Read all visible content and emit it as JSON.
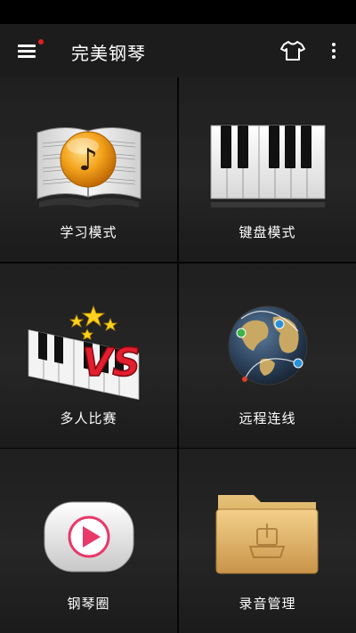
{
  "app_bar": {
    "title": "完美钢琴",
    "menu_icon": "hamburger-menu-icon",
    "notification_dot_color": "#e02020",
    "theme_icon": "tshirt-icon",
    "more_icon": "more-vertical-icon"
  },
  "tiles": [
    {
      "label": "学习模式",
      "icon": "music-book-icon"
    },
    {
      "label": "键盘模式",
      "icon": "piano-keys-icon"
    },
    {
      "label": "多人比赛",
      "icon": "vs-piano-icon"
    },
    {
      "label": "远程连线",
      "icon": "globe-network-icon"
    },
    {
      "label": "钢琴圈",
      "icon": "play-circle-icon"
    },
    {
      "label": "录音管理",
      "icon": "folder-icon"
    }
  ],
  "colors": {
    "background": "#0d0d0d",
    "toolbar": "#1c1c1c",
    "play_accent": "#e8396a",
    "music_note_orange": "#f0a020",
    "folder_tan": "#e0b060"
  }
}
